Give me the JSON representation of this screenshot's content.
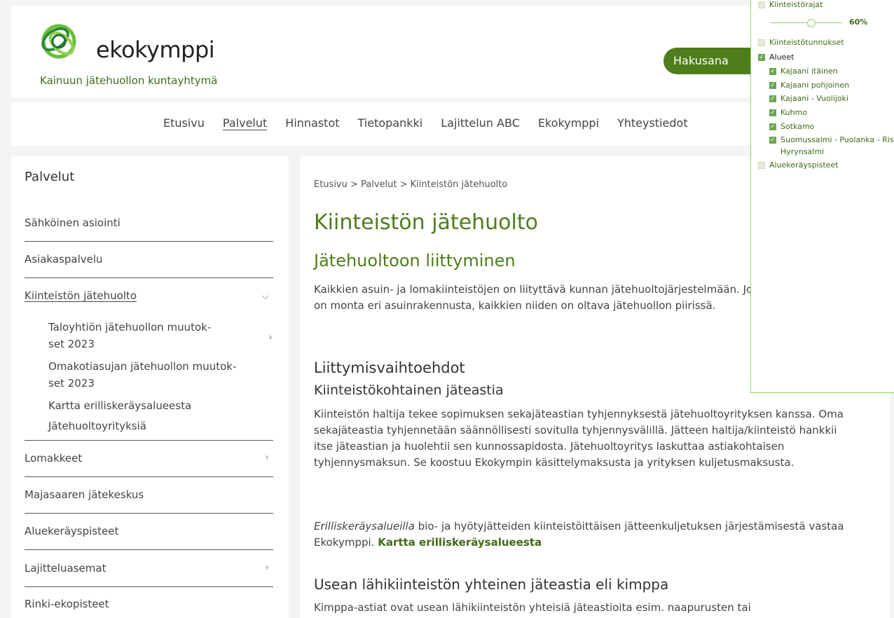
{
  "header": {
    "logo_text": "ekokymppi",
    "subtitle": "Kainuun jätehuollon kuntayhtymä",
    "search_label": "Hakusana"
  },
  "nav": {
    "items": [
      "Etusivu",
      "Palvelut",
      "Hinnastot",
      "Tietopankki",
      "Lajittelun ABC",
      "Ekokymppi",
      "Yhteystiedot"
    ],
    "active": "Palvelut"
  },
  "sidebar": {
    "title": "Palvelut",
    "items": [
      {
        "label": "Sähköinen asiointi"
      },
      {
        "label": "Asiakaspalvelu"
      },
      {
        "label": "Kiinteistön jätehuolto"
      },
      {
        "label": "Lomakkeet"
      },
      {
        "label": "Majasaaren jätekeskus"
      },
      {
        "label": "Aluekeräyspisteet"
      },
      {
        "label": "Lajitteluasemat"
      },
      {
        "label": "Rinki-ekopisteet"
      }
    ],
    "sub_items": [
      {
        "line1": "Taloyhtiön jätehuollon muutok-",
        "line2": "set 2023"
      },
      {
        "line1": "Omakotiasujan jätehuollon muutok-",
        "line2": "set 2023"
      },
      {
        "line1": "Kartta erilliskeräysalueesta"
      },
      {
        "line1": "Jätehuoltoyrityksiä"
      }
    ]
  },
  "main": {
    "breadcrumb": "Etusivu > Palvelut > Kiinteistön jätehuolto",
    "title": "Kiinteistön jätehuolto",
    "heading_join": "Jätehuoltoon liittyminen",
    "para_join": "Kaikkien asuin- ja lomakiinteistöjen on liityttävä kunnan jätehuoltojärjestelmään. Jos samalla kiinteistöllä on monta eri asuinrakennusta, kaikkien niiden on oltava jätehuollon piirissä.",
    "heading_options": "Liittymisvaihtoehdot",
    "heading_property": "Kiinteistökohtainen jäteastia",
    "para_property": "Kiinteistön haltija tekee sopimuksen sekajäteastian tyhjennyksestä jätehuoltoyrityksen kanssa. Oma sekajäteastia tyhjennetään säännöllisesti sovitulla tyhjennysvälillä. Jätteen haltija/kiinteistö hankkii itse jäteastian ja huolehtii sen kunnossapidosta. Jätehuoltoyritys laskuttaa astiakohtaisen tyhjennysmaksun. Se koostuu Ekokympin käsittelymaksusta ja yrityksen kuljetusmaksusta.",
    "para_separate_em": "Erilliskeräysalueilla",
    "para_separate_rest": " bio- ja hyötyjätteiden kiinteistöittäisen jätteenkuljetuksen järjestämisestä vastaa Ekokymppi. ",
    "para_separate_link": "Kartta erilliskeräysalueesta",
    "heading_kimppa": "Usean lähikiinteistön yhteinen jäteastia eli kimppa",
    "para_kimppa": "Kimppa-astiat ovat usean lähikiinteistön yhteisiä jäteastioita esim. naapurusten tai"
  },
  "layer_panel": {
    "property_borders": "Kiinteistörajat",
    "opacity": "60%",
    "property_ids": "Kiinteistötunnukset",
    "areas": "Alueet",
    "area_items": [
      "Kajaani itäinen",
      "Kajaani pohjoinen",
      "Kajaani - Vuolijoki",
      "Kuhmo",
      "Sotkamo",
      "Suomussalmi - Puolanka - Ristijärvi -",
      "Hyrynsalmi"
    ],
    "collection_points": "Aluekeräyspisteet"
  },
  "colors": {
    "brand_green": "#4e7d1c",
    "panel_border": "#9ccc65"
  }
}
